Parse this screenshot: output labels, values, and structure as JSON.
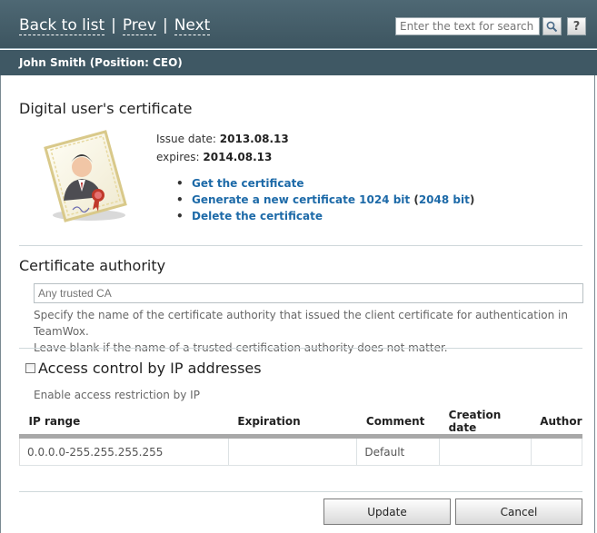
{
  "nav": {
    "back": "Back to list",
    "sep1": "|",
    "prev": "Prev",
    "sep2": "|",
    "next": "Next"
  },
  "search": {
    "placeholder": "Enter the text for search"
  },
  "help": {
    "label": "?"
  },
  "user": {
    "title": "John Smith (Position: CEO)"
  },
  "certificate": {
    "heading": "Digital user's certificate",
    "issue_label": "Issue date:",
    "issue_date": "2013.08.13",
    "expires_label": "expires:",
    "expires_date": "2014.08.13",
    "links": {
      "get": "Get the certificate",
      "generate": "Generate a new certificate 1024 bit",
      "paren_open": "(",
      "generate_2048": "2048 bit",
      "paren_close": ")",
      "delete": "Delete the certificate"
    }
  },
  "authority": {
    "heading": "Certificate authority",
    "placeholder": "Any trusted CA",
    "hint1": "Specify the name of the certificate authority that issued the client certificate for authentication in TeamWox.",
    "hint2": "Leave blank if the name of a trusted certification authority does not matter."
  },
  "ip": {
    "heading": "Access control by IP addresses",
    "subtext": "Enable access restriction by IP",
    "columns": [
      "IP range",
      "Expiration",
      "Comment",
      "Creation date",
      "Author"
    ],
    "rows": [
      [
        "0.0.0.0-255.255.255.255",
        "",
        "Default",
        "",
        ""
      ]
    ]
  },
  "buttons": {
    "update": "Update",
    "cancel": "Cancel"
  },
  "colors": {
    "header": "#4a6470",
    "link": "#1d6aa8"
  }
}
